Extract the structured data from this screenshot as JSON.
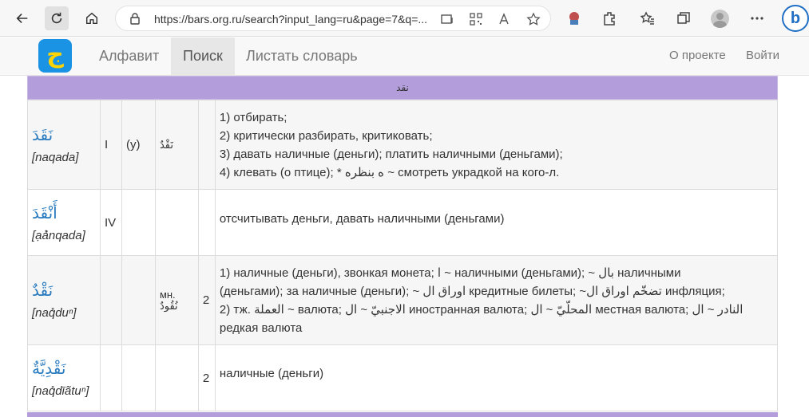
{
  "browser": {
    "url": "https://bars.org.ru/search?input_lang=ru&page=7&q=..."
  },
  "site": {
    "logo_glyph": "ج",
    "nav": [
      {
        "label": "Алфавит"
      },
      {
        "label": "Поиск",
        "active": true
      },
      {
        "label": "Листать словарь"
      }
    ],
    "nav_right": [
      {
        "label": "О проекте"
      },
      {
        "label": "Войти"
      }
    ]
  },
  "results": {
    "root_header": "نقد",
    "rows": [
      {
        "word": "نَقَدَ",
        "translit": "[naqada]",
        "form": "I",
        "vowel": "(у)",
        "plural": "نَقْدٌ",
        "count": "",
        "meanings": [
          "1) отбирать;",
          "2) критически разбирать, критиковать;",
          "3) давать наличные (деньги); платить наличными (деньгами);",
          "4) клевать (о птице); * ه بنظره ~ смотреть украдкой на кого-л."
        ]
      },
      {
        "word": "أَنْقَدَ",
        "translit": "[ạả̊nqada]",
        "form": "IV",
        "vowel": "",
        "plural": "",
        "count": "",
        "meanings": [
          "отсчитывать деньги, давать наличными (деньгами)"
        ]
      },
      {
        "word": "نَقْدٌ",
        "translit": "[naq̊duⁿ]",
        "form": "",
        "vowel": "",
        "plural_label": "мн.",
        "plural": "نُقُودٌ",
        "count": "2",
        "meanings": [
          "1) наличные (деньги), звонкая монета; ا ~ наличными (деньгами); ~ بال наличными",
          "(деньгами); за наличные (деньги); ~ اوراق ال кредитные билеты; ~تضخّم اوراق ال инфляция;",
          "2) тж. العملة ~ валюта; الاجنبيّ ~ ال иностранная валюта; المحلّيّ ~ ال местная валюта; النادر ~ ال",
          "редкая валюта"
        ]
      },
      {
        "word": "نَقْدِيَّةٌ",
        "translit": "[naq̊dīãtuⁿ]",
        "form": "",
        "vowel": "",
        "plural": "",
        "count": "2",
        "meanings": [
          "наличные (деньги)"
        ]
      }
    ]
  },
  "colors": {
    "band": "#b39ddb",
    "link": "#2a7bbf",
    "logo_bg": "#1b93e5",
    "logo_fg": "#ffd400"
  }
}
